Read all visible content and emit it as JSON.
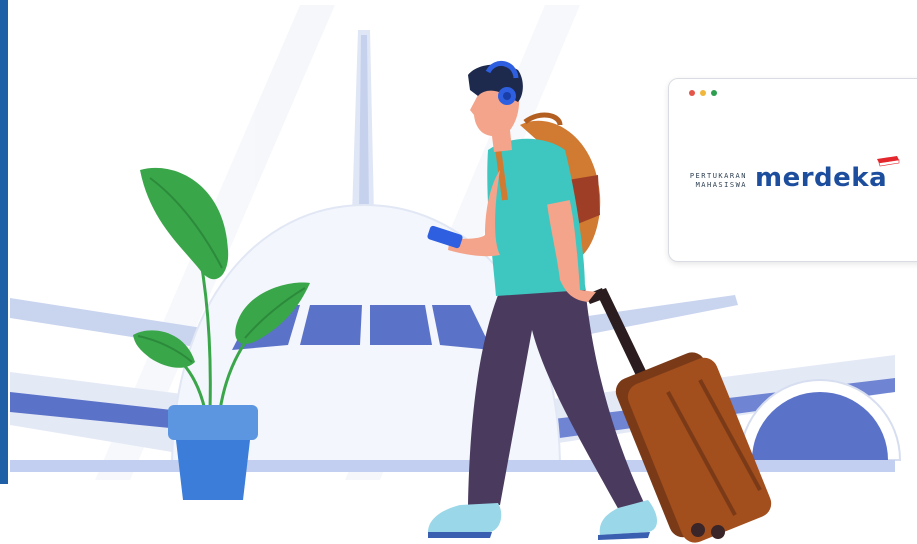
{
  "logo": {
    "line1": "PERTUKARAN",
    "line2": "MAHASISWA",
    "wordmark": "merdeka",
    "flag_icon": "indonesia-flag-icon"
  },
  "window_controls": [
    "red-dot",
    "yellow-dot",
    "green-dot"
  ],
  "colors": {
    "brand_blue": "#1d4e9e",
    "stripe": "#1f5fa6",
    "plane_fill": "#f3f6fc",
    "plane_accent": "#5b72c9",
    "shirt": "#3ec6c0",
    "backpack": "#d07a32",
    "suitcase": "#a24e1d",
    "plant": "#3aa64a",
    "pot": "#3b7dd8"
  }
}
